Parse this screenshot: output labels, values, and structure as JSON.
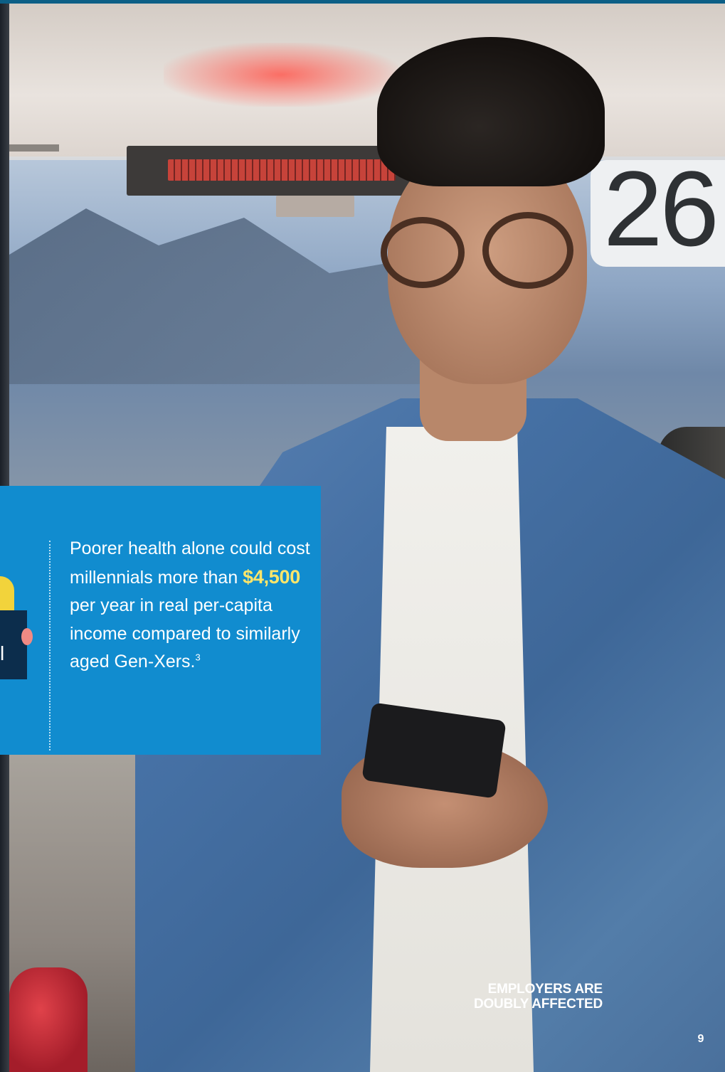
{
  "callout": {
    "text_before": "Poorer health alone could cost millennials more than ",
    "highlight": "$4,500",
    "text_after": " per year in real per-capita income compared to similarly aged Gen-Xers.",
    "footnote": "3",
    "panel_color": "#118ccf",
    "highlight_color": "#ffe66a"
  },
  "side_tab": {
    "letter": "l"
  },
  "photo": {
    "number_sign": "26"
  },
  "section_label": "EMPLOYERS ARE DOUBLY AFFECTED",
  "page_number": "9",
  "colors": {
    "top_rule": "#0c5f86",
    "dark_tab": "#0c2d4c",
    "accent_yellow": "#f2d33b",
    "accent_pink": "#f08a84"
  }
}
